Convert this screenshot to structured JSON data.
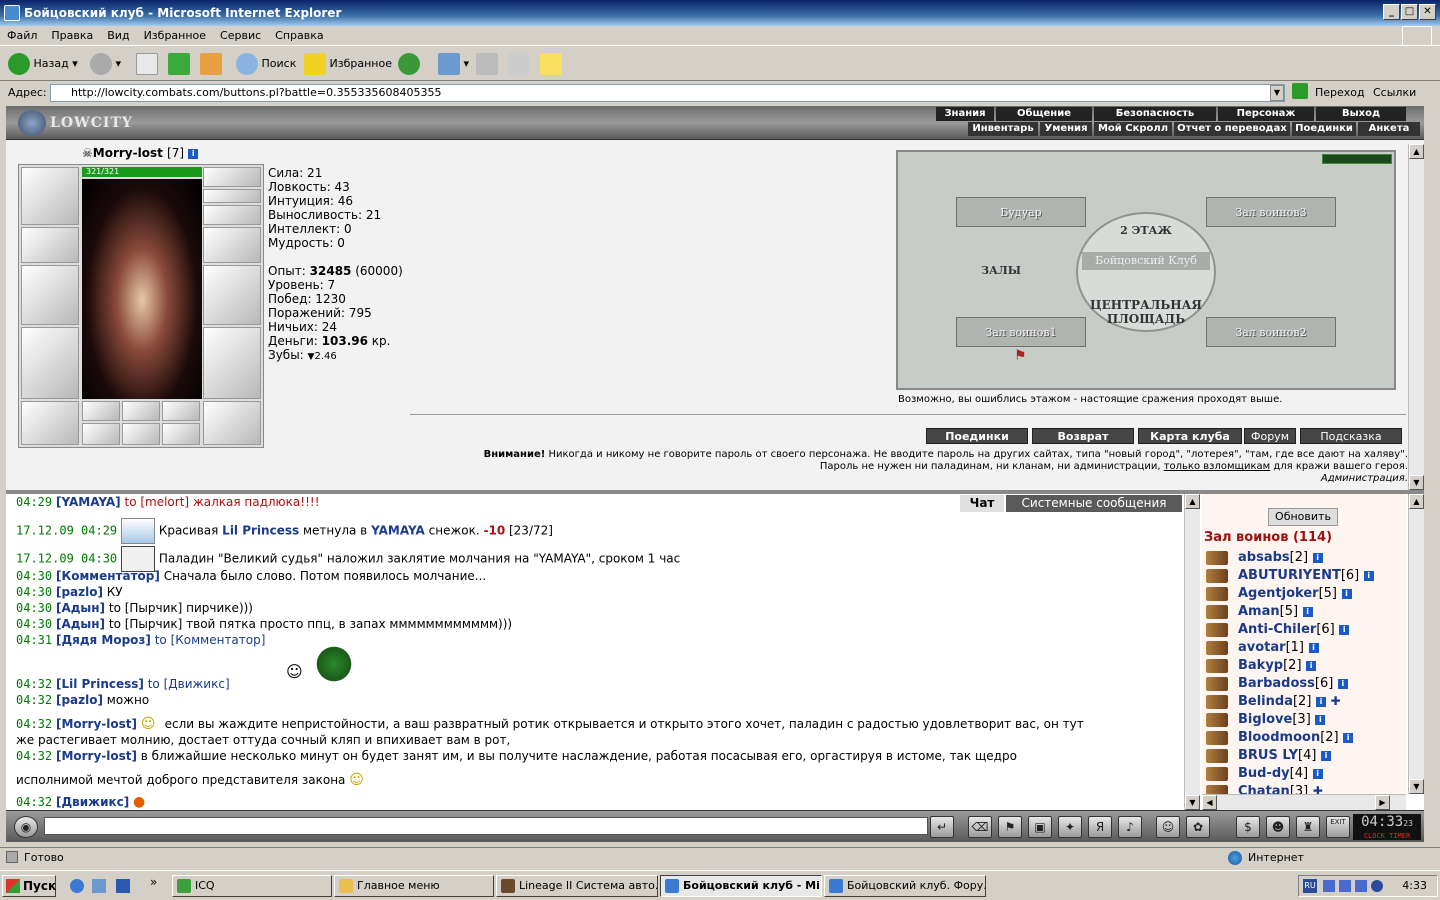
{
  "window": {
    "title": "Бойцовский клуб - Microsoft Internet Explorer"
  },
  "menu": [
    "Файл",
    "Правка",
    "Вид",
    "Избранное",
    "Сервис",
    "Справка"
  ],
  "toolbar": {
    "back": "Назад",
    "search": "Поиск",
    "favorites": "Избранное"
  },
  "address": {
    "label": "Адрес:",
    "url": "http://lowcity.combats.com/buttons.pl?battle=0.355335608405355",
    "go": "Переход",
    "links": "Ссылки"
  },
  "game_nav": {
    "logo": "LOWCITY",
    "top": [
      "Знания",
      "Общение",
      "Безопасность",
      "Персонаж",
      "Выход"
    ],
    "bottom": [
      "Инвентарь",
      "Умения",
      "Мой Скролл",
      "Отчет о переводах",
      "Поединки",
      "Анкета"
    ]
  },
  "character": {
    "name": "Morry-lost",
    "level": "[7]",
    "hp": "321/321",
    "stats": [
      "Сила: 21",
      "Ловкость: 43",
      "Интуиция: 46",
      "Выносливость: 21",
      "Интеллект: 0",
      "Мудрость: 0"
    ],
    "exp_label": "Опыт:",
    "exp_value": "32485",
    "exp_next": "(60000)",
    "info": [
      "Уровень: 7",
      "Побед: 1230",
      "Поражений: 795",
      "Ничьих: 24"
    ],
    "money_label": "Деньги:",
    "money_value": "103.96",
    "money_unit": "кр.",
    "teeth_label": "Зубы:",
    "teeth_value": "2.46"
  },
  "map": {
    "rooms": [
      "Будуар",
      "Зал воинов3",
      "Зал воинов1",
      "Зал воинов2"
    ],
    "floor": "2 ЭТАЖ",
    "club": "Бойцовский Клуб",
    "halls": "ЗАЛЫ",
    "square1": "ЦЕНТРАЛЬНАЯ",
    "square2": "ПЛОЩАДЬ",
    "message": "Возможно, вы ошиблись этажом - настоящие сражения проходят выше."
  },
  "buttons": [
    "Поединки",
    "Возврат",
    "Карта клуба",
    "Форум",
    "Подсказка"
  ],
  "warning": {
    "bold": "Внимание!",
    "line1": " Никогда и никому не говорите пароль от своего персонажа. Не вводите пароль на других сайтах, типа \"новый город\", \"лотерея\", \"там, где все дают на халяву\".",
    "line2a": "Пароль не нужен ни паладинам, ни кланам, ни администрации, ",
    "line2link": "только взломщикам",
    "line2b": " для кражи вашего героя.",
    "sign": "Администрация."
  },
  "chat_tabs": [
    "Чат",
    "Системные сообщения"
  ],
  "chat": [
    {
      "time": "04:29",
      "nick": "[YAMAYA]",
      "to": " to [melort] ",
      "text": "жалкая падлюка!!!!",
      "textcolor": "#b01010"
    },
    {
      "time": "17.12.09 04:29",
      "pre": "Красивая ",
      "nick": "Lil Princess",
      "mid": " метнула в ",
      "nick2": "YAMAYA",
      "text": " снежок. ",
      "dmg": "-10",
      "tail": " [23/72]"
    },
    {
      "time": "17.12.09 04:30",
      "text": "Паладин \"Великий судья\" наложил заклятие молчания на \"YAMAYA\", сроком 1 час"
    },
    {
      "time": "04:30",
      "nick": "[Комментатор]",
      "text": " Сначала было слово. Потом появилось молчание..."
    },
    {
      "time": "04:30",
      "nick": "[pazlo]",
      "text": " КУ"
    },
    {
      "time": "04:30",
      "nick": "[Адын]",
      "to": " to [Пырчик] ",
      "text": "пирчике)))"
    },
    {
      "time": "04:30",
      "nick": "[Адын]",
      "to": " to [Пырчик] ",
      "text": "твой пятка просто ппц, в запах мммммммммммм)))"
    },
    {
      "time": "04:31",
      "nick": "[Дядя Мороз]",
      "to": " to [Комментатор]",
      "text": ""
    },
    {
      "time": "04:32",
      "nick": "[Lil Princess]",
      "to": " to [Движикс]",
      "text": ""
    },
    {
      "time": "04:32",
      "nick": "[pazlo]",
      "text": " можно"
    },
    {
      "time": "04:32",
      "nick": "[Morry-lost]",
      "text": "если вы жаждите непристойности, а ваш развратный ротик открывается и открыто этого хочет, паладин с радостью удовлетворит вас, он тут",
      "text2": "же растегивает молнию, достает оттуда сочный кляп и впихивает вам в рот,"
    },
    {
      "time": "04:32",
      "nick": "[Morry-lost]",
      "text": " в ближайшие несколько минут он будет занят им, и вы получите наслаждение, работая посасывая его, оргастируя в истоме, так щедро",
      "text2": "исполнимой мечтой доброго представителя закона"
    },
    {
      "time": "04:32",
      "nick": "[Движикс]",
      "text": ""
    }
  ],
  "users_panel": {
    "refresh": "Обновить",
    "room": "Зал воинов (114)",
    "users": [
      {
        "name": "absabs",
        "lvl": "[2]"
      },
      {
        "name": "ABUTURIYENT",
        "lvl": "[6]"
      },
      {
        "name": "Agentjoker",
        "lvl": "[5]"
      },
      {
        "name": "Aman",
        "lvl": "[5]"
      },
      {
        "name": "Anti-Chiler",
        "lvl": "[6]"
      },
      {
        "name": "avotar",
        "lvl": "[1]"
      },
      {
        "name": "Bakyp",
        "lvl": "[2]"
      },
      {
        "name": "Barbadoss",
        "lvl": "[6]"
      },
      {
        "name": "Belinda",
        "lvl": "[2]"
      },
      {
        "name": "Biglove",
        "lvl": "[3]"
      },
      {
        "name": "Bloodmoon",
        "lvl": "[2]"
      },
      {
        "name": "BRUS LY",
        "lvl": "[4]"
      },
      {
        "name": "Bud-dy",
        "lvl": "[4]"
      },
      {
        "name": "Chatan",
        "lvl": "[3]"
      }
    ]
  },
  "clock": {
    "time": "04:33",
    "sec": "23",
    "label1": "CLOCK",
    "label2": "TIMER",
    "exit": "EXIT"
  },
  "status": {
    "text": "Готово",
    "zone": "Интернет"
  },
  "taskbar": {
    "start": "Пуск",
    "tasks": [
      "ICQ",
      "Главное меню",
      "Lineage II Система авто...",
      "Бойцовский клуб - Mi...",
      "Бойцовский клуб. Фору..."
    ],
    "lang": "RU",
    "time": "4:33"
  }
}
